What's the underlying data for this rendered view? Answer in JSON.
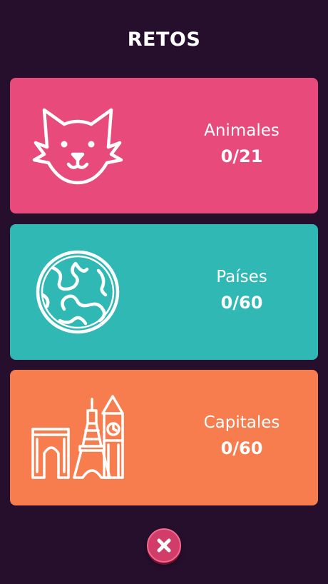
{
  "header": {
    "title": "RETOS"
  },
  "colors": {
    "background": "#250f2c",
    "animales": "#e84a7c",
    "paises": "#2fb8b4",
    "capitales": "#f77d4f",
    "close_button": "#d23c68"
  },
  "challenges": [
    {
      "name": "Animales",
      "progress": "0/21",
      "icon": "cat-icon"
    },
    {
      "name": "Países",
      "progress": "0/60",
      "icon": "globe-icon"
    },
    {
      "name": "Capitales",
      "progress": "0/60",
      "icon": "landmarks-icon"
    }
  ],
  "close": {
    "icon": "close-icon"
  }
}
